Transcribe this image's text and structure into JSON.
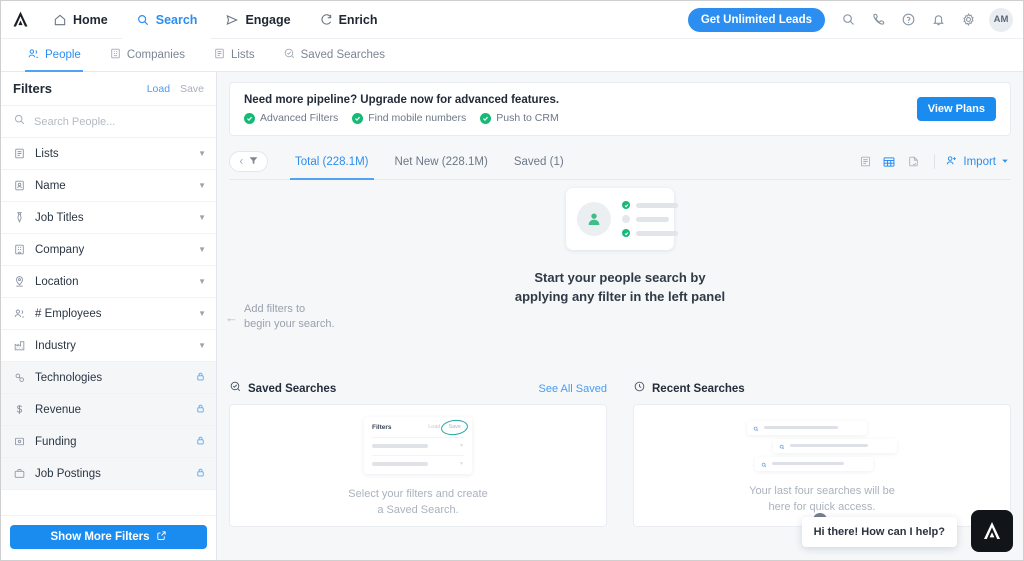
{
  "topnav": {
    "logo_alt": "apollo-logo",
    "items": [
      {
        "label": "Home",
        "icon": "home-icon",
        "active": false
      },
      {
        "label": "Search",
        "icon": "search-icon",
        "active": true
      },
      {
        "label": "Engage",
        "icon": "send-icon",
        "active": false
      },
      {
        "label": "Enrich",
        "icon": "refresh-icon",
        "active": false
      }
    ],
    "cta_label": "Get Unlimited Leads",
    "icons": [
      "search-icon",
      "phone-icon",
      "help-icon",
      "bell-icon",
      "gear-icon"
    ],
    "avatar_initials": "AM"
  },
  "subnav": {
    "items": [
      {
        "label": "People",
        "icon": "people-icon",
        "active": true
      },
      {
        "label": "Companies",
        "icon": "building-icon",
        "active": false
      },
      {
        "label": "Lists",
        "icon": "list-icon",
        "active": false
      },
      {
        "label": "Saved Searches",
        "icon": "saved-search-icon",
        "active": false
      }
    ]
  },
  "sidebar": {
    "title": "Filters",
    "load_label": "Load",
    "save_label": "Save",
    "search_placeholder": "Search People...",
    "search_value": "",
    "filters": [
      {
        "label": "Lists",
        "icon": "list-icon",
        "locked": false
      },
      {
        "label": "Name",
        "icon": "badge-icon",
        "locked": false
      },
      {
        "label": "Job Titles",
        "icon": "tie-icon",
        "locked": false
      },
      {
        "label": "Company",
        "icon": "building-icon",
        "locked": false
      },
      {
        "label": "Location",
        "icon": "pin-icon",
        "locked": false
      },
      {
        "label": "# Employees",
        "icon": "people-icon",
        "locked": false
      },
      {
        "label": "Industry",
        "icon": "factory-icon",
        "locked": false
      },
      {
        "label": "Technologies",
        "icon": "tech-icon",
        "locked": true
      },
      {
        "label": "Revenue",
        "icon": "dollar-icon",
        "locked": true
      },
      {
        "label": "Funding",
        "icon": "bank-icon",
        "locked": true
      },
      {
        "label": "Job Postings",
        "icon": "briefcase-icon",
        "locked": true
      }
    ],
    "show_more_label": "Show More Filters"
  },
  "banner": {
    "title": "Need more pipeline? Upgrade now for advanced features.",
    "features": [
      "Advanced Filters",
      "Find mobile numbers",
      "Push to CRM"
    ],
    "button_label": "View Plans"
  },
  "tabbar": {
    "tabs": [
      {
        "label": "Total (228.1M)",
        "active": true
      },
      {
        "label": "Net New (228.1M)",
        "active": false
      },
      {
        "label": "Saved (1)",
        "active": false
      }
    ],
    "view_icons": [
      "list-view-icon",
      "table-view-icon",
      "export-view-icon"
    ],
    "import_label": "Import"
  },
  "empty_state": {
    "hint_line1": "Add filters to",
    "hint_line2": "begin your search.",
    "title_line1": "Start your people search by",
    "title_line2": "applying any filter in the left panel"
  },
  "saved_searches": {
    "title": "Saved Searches",
    "see_all_label": "See All Saved",
    "illustration": {
      "filters_label": "Filters",
      "load_label": "Load",
      "save_label": "Save"
    },
    "empty_line1": "Select your filters and create",
    "empty_line2": "a Saved Search."
  },
  "recent_searches": {
    "title": "Recent Searches",
    "empty_line1": "Your last four searches will be",
    "empty_line2": "here for quick access."
  },
  "chat": {
    "message": "Hi there! How can I help?",
    "close_label": "✕"
  },
  "colors": {
    "accent_blue": "#1a8cf0",
    "link_blue": "#4a9cf0",
    "success_green": "#18b877",
    "teal": "#23a6a0",
    "page_bg": "#f5f7f9",
    "dark": "#111418"
  }
}
